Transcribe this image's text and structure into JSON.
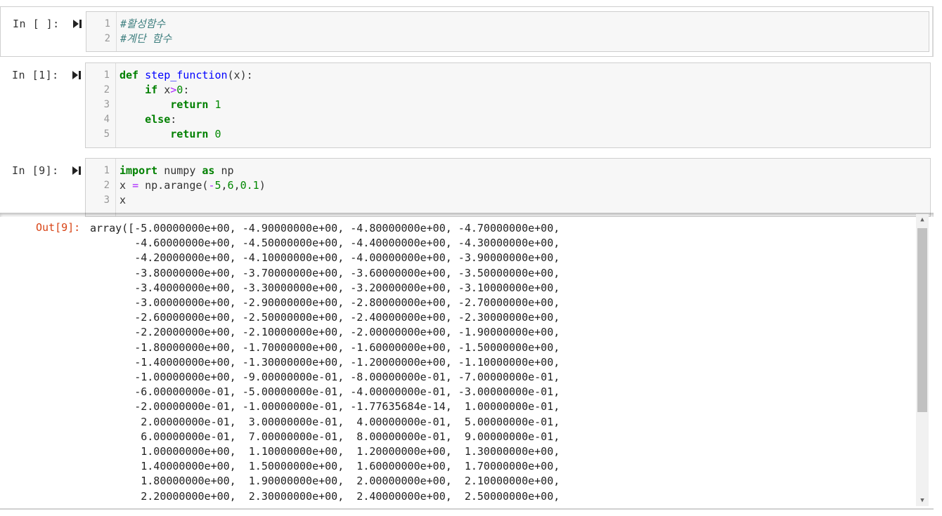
{
  "cells": [
    {
      "prompt": "In [ ]:",
      "lines": [
        "#활성함수",
        "#계단 함수"
      ]
    },
    {
      "prompt": "In [1]:",
      "lines": [
        "def step_function(x):",
        "    if x>0:",
        "        return 1",
        "    else:",
        "        return 0"
      ]
    },
    {
      "prompt": "In [9]:",
      "lines": [
        "import numpy as np",
        "x = np.arange(-5,6,0.1)",
        "x"
      ]
    }
  ],
  "output": {
    "prompt": "Out[9]:",
    "text": "array([-5.00000000e+00, -4.90000000e+00, -4.80000000e+00, -4.70000000e+00,\n       -4.60000000e+00, -4.50000000e+00, -4.40000000e+00, -4.30000000e+00,\n       -4.20000000e+00, -4.10000000e+00, -4.00000000e+00, -3.90000000e+00,\n       -3.80000000e+00, -3.70000000e+00, -3.60000000e+00, -3.50000000e+00,\n       -3.40000000e+00, -3.30000000e+00, -3.20000000e+00, -3.10000000e+00,\n       -3.00000000e+00, -2.90000000e+00, -2.80000000e+00, -2.70000000e+00,\n       -2.60000000e+00, -2.50000000e+00, -2.40000000e+00, -2.30000000e+00,\n       -2.20000000e+00, -2.10000000e+00, -2.00000000e+00, -1.90000000e+00,\n       -1.80000000e+00, -1.70000000e+00, -1.60000000e+00, -1.50000000e+00,\n       -1.40000000e+00, -1.30000000e+00, -1.20000000e+00, -1.10000000e+00,\n       -1.00000000e+00, -9.00000000e-01, -8.00000000e-01, -7.00000000e-01,\n       -6.00000000e-01, -5.00000000e-01, -4.00000000e-01, -3.00000000e-01,\n       -2.00000000e-01, -1.00000000e-01, -1.77635684e-14,  1.00000000e-01,\n        2.00000000e-01,  3.00000000e-01,  4.00000000e-01,  5.00000000e-01,\n        6.00000000e-01,  7.00000000e-01,  8.00000000e-01,  9.00000000e-01,\n        1.00000000e+00,  1.10000000e+00,  1.20000000e+00,  1.30000000e+00,\n        1.40000000e+00,  1.50000000e+00,  1.60000000e+00,  1.70000000e+00,\n        1.80000000e+00,  1.90000000e+00,  2.00000000e+00,  2.10000000e+00,\n        2.20000000e+00,  2.30000000e+00,  2.40000000e+00,  2.50000000e+00,"
  },
  "icons": {
    "run": "run-cell-icon",
    "scroll_up": "arrow-up-icon",
    "scroll_down": "arrow-down-icon"
  }
}
